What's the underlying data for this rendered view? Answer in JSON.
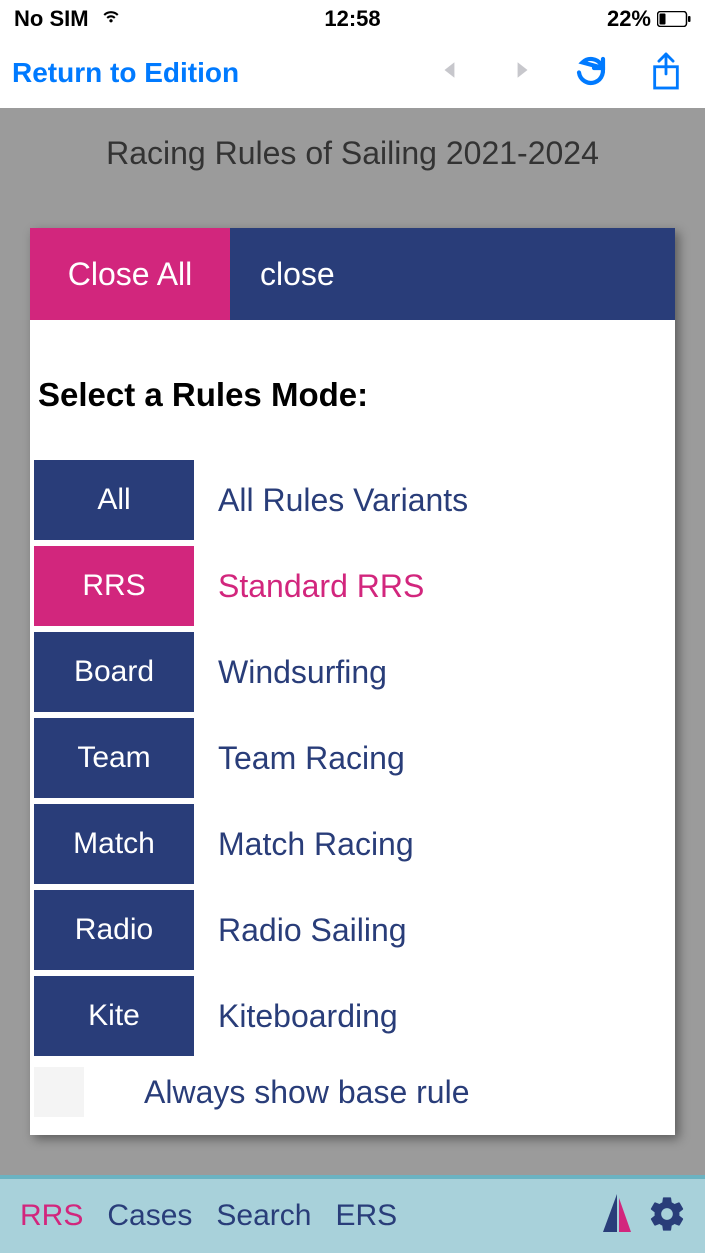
{
  "status": {
    "sim": "No SIM",
    "time": "12:58",
    "battery_pct": "22%"
  },
  "nav": {
    "back_label": "Return to Edition"
  },
  "page": {
    "title": "Racing Rules of Sailing 2021-2024"
  },
  "modal": {
    "close_all": "Close All",
    "close": "close",
    "prompt": "Select a Rules Mode:",
    "modes": [
      {
        "code": "All",
        "label": "All Rules Variants",
        "active": false
      },
      {
        "code": "RRS",
        "label": "Standard RRS",
        "active": true
      },
      {
        "code": "Board",
        "label": "Windsurfing",
        "active": false
      },
      {
        "code": "Team",
        "label": "Team Racing",
        "active": false
      },
      {
        "code": "Match",
        "label": "Match Racing",
        "active": false
      },
      {
        "code": "Radio",
        "label": "Radio Sailing",
        "active": false
      },
      {
        "code": "Kite",
        "label": "Kiteboarding",
        "active": false
      }
    ],
    "always_label": "Always show base rule"
  },
  "tabs": {
    "items": [
      "RRS",
      "Cases",
      "Search",
      "ERS"
    ],
    "active_index": 0
  }
}
